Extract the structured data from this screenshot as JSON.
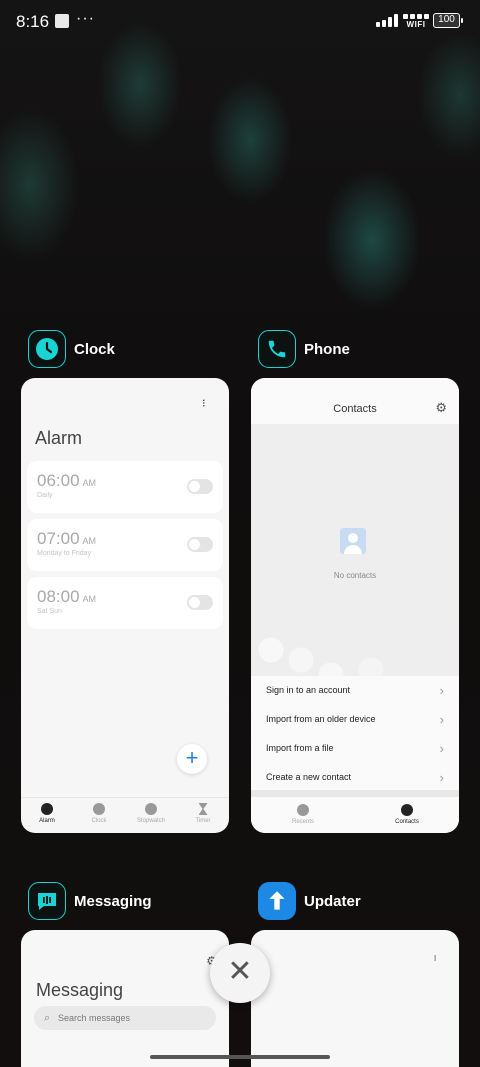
{
  "status_bar": {
    "time": "8:16",
    "menu_dots": "···",
    "network_label": "WIFI",
    "battery_level": "100"
  },
  "recents": [
    {
      "app_name": "Clock",
      "icon": "clock-icon",
      "preview": {
        "title": "Alarm",
        "alarms": [
          {
            "time": "06:00",
            "period": "AM",
            "repeat": "Daily",
            "enabled": false
          },
          {
            "time": "07:00",
            "period": "AM",
            "repeat": "Monday to Friday",
            "enabled": false
          },
          {
            "time": "08:00",
            "period": "AM",
            "repeat": "Sat Sun",
            "enabled": false
          }
        ],
        "fab": "+",
        "nav": [
          "Alarm",
          "Clock",
          "Stopwatch",
          "Timer"
        ],
        "nav_active": "Alarm"
      }
    },
    {
      "app_name": "Phone",
      "icon": "phone-icon",
      "preview": {
        "title": "Contacts",
        "empty_text": "No contacts",
        "actions": [
          "Sign in to an account",
          "Import from an older device",
          "Import from a file",
          "Create a new contact"
        ],
        "nav": [
          "Recents",
          "Contacts"
        ],
        "nav_active": "Contacts"
      }
    },
    {
      "app_name": "Messaging",
      "icon": "message-icon",
      "preview": {
        "title": "Messaging",
        "search_placeholder": "Search messages"
      }
    },
    {
      "app_name": "Updater",
      "icon": "updater-icon",
      "preview": {}
    }
  ],
  "close_symbol": "✕",
  "colors": {
    "accent": "#1ad3d3",
    "updater_blue": "#1e88e5"
  }
}
